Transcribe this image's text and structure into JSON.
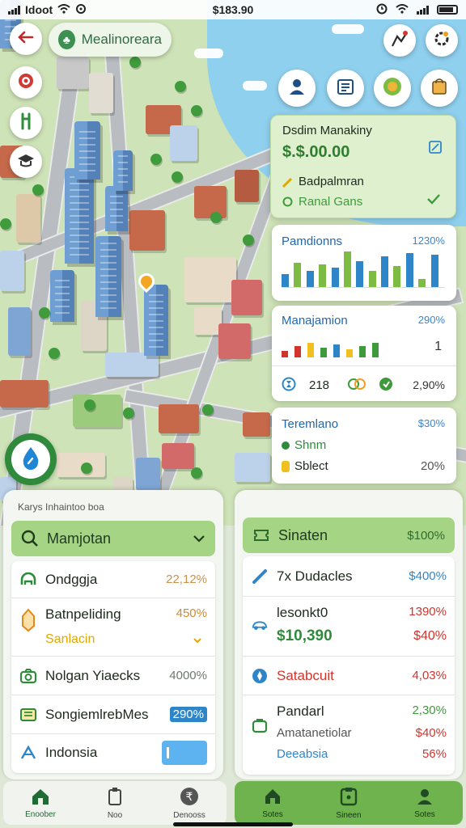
{
  "status_bar": {
    "carrier": "Idoot",
    "time": "$183.90"
  },
  "map": {
    "location_pill": {
      "label": "Mealinoreara"
    }
  },
  "cards": {
    "money": {
      "title": "Dsdim Manakiny",
      "amount": "$.$.00.00",
      "line1": "Badpalmran",
      "line2": "Ranal Gans"
    },
    "pandions": {
      "title": "Pamdionns",
      "value": "1230%",
      "bars": [
        16,
        30,
        20,
        28,
        24,
        44,
        32,
        20,
        38,
        26,
        42,
        10,
        40
      ]
    },
    "manajamion": {
      "title": "Manajamion",
      "value": "290%",
      "bars": [
        8,
        14,
        18,
        12,
        16,
        10,
        14,
        18
      ],
      "stat1": "218",
      "stat2": "2,90%",
      "side_mark": "1"
    },
    "teremlano": {
      "title": "Teremlano",
      "value": "$30%",
      "line1": "Shnm",
      "line2": "Sblect",
      "line2_value": "20%"
    }
  },
  "panel_left": {
    "caption": "Karys Inhaintoo boa",
    "header": "Mamjotan",
    "rows": [
      {
        "label": "Ondggja",
        "value": "22,12%",
        "color": "#c9924a",
        "icon": "helmet-icon"
      },
      {
        "label": "Batnpeliding",
        "value": "450%",
        "color": "#d08a2a",
        "sub": "Sanlacin",
        "icon": "lantern-icon"
      },
      {
        "label": "Nolgan Yiaecks",
        "value": "4000%",
        "color": "#6b7a6b",
        "icon": "camera-icon"
      },
      {
        "label": "SongiemlrebMes",
        "value": "290%",
        "color": "#2e86c9",
        "icon": "list-icon"
      },
      {
        "label": "Indonsia",
        "icon": "road-icon"
      }
    ]
  },
  "panel_right": {
    "header": "Sinaten",
    "header_value": "$100%",
    "rows": [
      {
        "label": "7x Dudacles",
        "value": "$400%",
        "color": "#2e86c9",
        "icon": "pencil-icon"
      },
      {
        "label": "lesonkt0",
        "value": "1390%",
        "color": "#d0342c",
        "amount": "$10,390",
        "amount_value": "$40%",
        "icon": "car-icon"
      },
      {
        "label": "Satabcuit",
        "value": "4,03%",
        "color": "#d0342c",
        "icon": "drop-icon"
      },
      {
        "label": "Pandarl",
        "value": "2,30%",
        "color": "#3e9a3a",
        "sub1": "Amatanetiolar",
        "sub1_value": "$40%",
        "sub2": "Deeabsia",
        "sub2_value": "56%",
        "icon": "bag-icon"
      }
    ]
  },
  "nav_left": [
    {
      "label": "Enoober",
      "icon": "home-icon"
    },
    {
      "label": "Noo",
      "icon": "clipboard-icon"
    },
    {
      "label": "Denooss",
      "icon": "coin-icon"
    }
  ],
  "nav_right": [
    {
      "label": "Sotes",
      "icon": "home-icon"
    },
    {
      "label": "Sineen",
      "icon": "calculator-icon"
    },
    {
      "label": "Sotes",
      "icon": "person-icon"
    }
  ]
}
